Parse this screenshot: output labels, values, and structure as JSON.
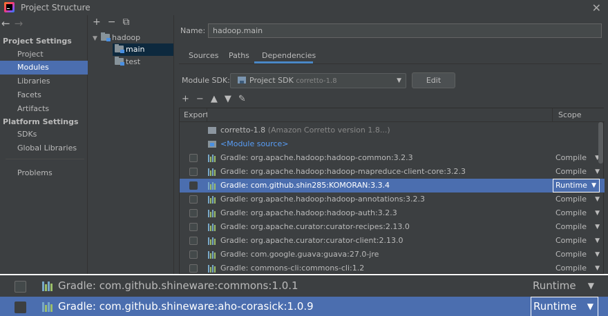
{
  "window": {
    "title": "Project Structure",
    "close_icon": "close-icon"
  },
  "sidebar": {
    "sections": [
      {
        "title": "Project Settings",
        "items": [
          "Project",
          "Modules",
          "Libraries",
          "Facets",
          "Artifacts"
        ]
      },
      {
        "title": "Platform Settings",
        "items": [
          "SDKs",
          "Global Libraries"
        ]
      }
    ],
    "extra_items": [
      "Problems"
    ],
    "selected": "Modules"
  },
  "tree": {
    "toolbar": [
      "+",
      "−",
      "⧉"
    ],
    "root": "hadoop",
    "children": [
      "main",
      "test"
    ],
    "selected": "main"
  },
  "module": {
    "name_label": "Name:",
    "name_value": "hadoop.main",
    "tabs": [
      "Sources",
      "Paths",
      "Dependencies"
    ],
    "active_tab": "Dependencies",
    "sdk_label": "Module SDK:",
    "sdk_value": "Project SDK",
    "sdk_sub": "corretto-1.8",
    "edit_label": "Edit",
    "dep_toolbar": [
      "+",
      "−",
      "▲",
      "▼",
      "✎"
    ]
  },
  "table": {
    "headers": {
      "export": "Export",
      "scope": "Scope"
    },
    "sdk_row": {
      "name": "corretto-1.8",
      "detail": "(Amazon Corretto version 1.8...)"
    },
    "source_row": "<Module source>",
    "rows": [
      {
        "name": "Gradle: org.apache.hadoop:hadoop-common:3.2.3",
        "scope": "Compile",
        "selected": false
      },
      {
        "name": "Gradle: org.apache.hadoop:hadoop-mapreduce-client-core:3.2.3",
        "scope": "Compile",
        "selected": false
      },
      {
        "name": "Gradle: com.github.shin285:KOMORAN:3.3.4",
        "scope": "Runtime",
        "selected": true
      },
      {
        "name": "Gradle: org.apache.hadoop:hadoop-annotations:3.2.3",
        "scope": "Compile",
        "selected": false
      },
      {
        "name": "Gradle: org.apache.hadoop:hadoop-auth:3.2.3",
        "scope": "Compile",
        "selected": false
      },
      {
        "name": "Gradle: org.apache.curator:curator-recipes:2.13.0",
        "scope": "Compile",
        "selected": false
      },
      {
        "name": "Gradle: org.apache.curator:curator-client:2.13.0",
        "scope": "Compile",
        "selected": false
      },
      {
        "name": "Gradle: com.google.guava:guava:27.0-jre",
        "scope": "Compile",
        "selected": false
      },
      {
        "name": "Gradle: commons-cli:commons-cli:1.2",
        "scope": "Compile",
        "selected": false
      }
    ]
  },
  "zoom": {
    "rows": [
      {
        "name": "Gradle: com.github.shineware:commons:1.0.1",
        "scope": "Runtime",
        "selected": false
      },
      {
        "name": "Gradle: com.github.shineware:aho-corasick:1.0.9",
        "scope": "Runtime",
        "selected": true
      }
    ]
  }
}
